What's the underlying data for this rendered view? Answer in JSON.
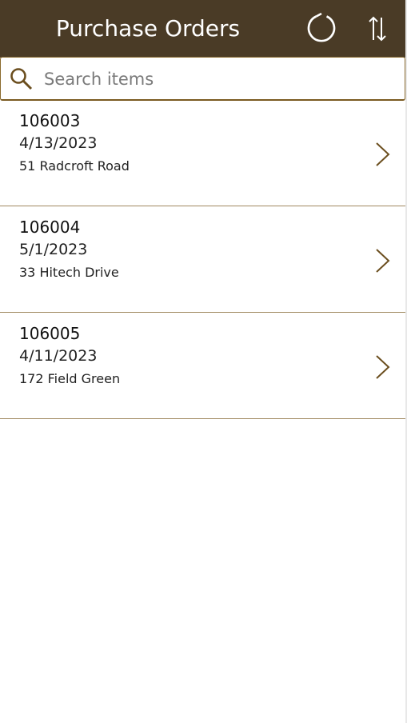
{
  "header": {
    "title": "Purchase Orders",
    "refresh_icon": "refresh-icon",
    "sort_icon": "sort-icon",
    "background_color": "#4a3b26"
  },
  "search": {
    "placeholder": "Search items",
    "value": "",
    "icon": "search-icon"
  },
  "orders": [
    {
      "id": "106003",
      "date": "4/13/2023",
      "address": "51 Radcroft Road"
    },
    {
      "id": "106004",
      "date": "5/1/2023",
      "address": "33 Hitech Drive"
    },
    {
      "id": "106005",
      "date": "4/11/2023",
      "address": "172 Field Green"
    }
  ],
  "colors": {
    "accent": "#6b4e1e",
    "divider": "#a08960"
  }
}
